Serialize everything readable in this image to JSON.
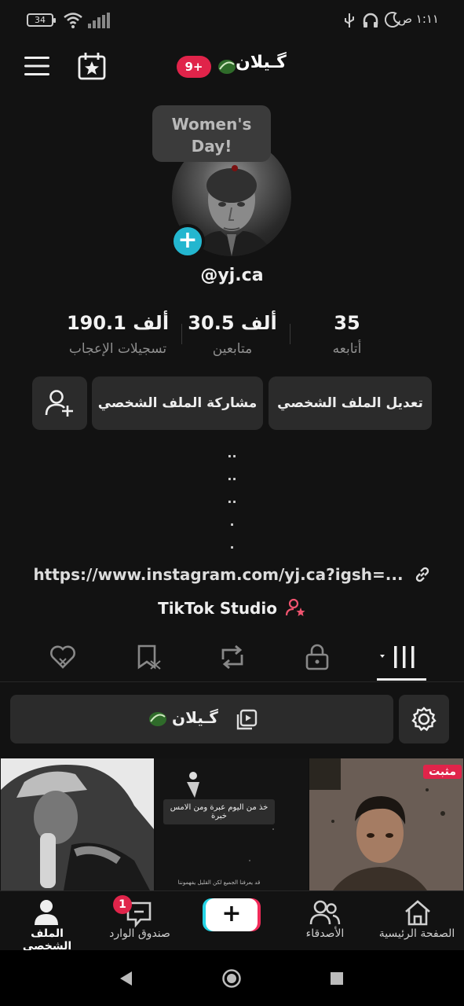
{
  "status_bar": {
    "battery": "34",
    "time": "١:١١ ص"
  },
  "header": {
    "title": "گـيلان",
    "notification_count": "9+"
  },
  "tooltip": {
    "text": "Women's Day!"
  },
  "profile": {
    "handle": "@yj.ca",
    "stats": [
      {
        "value": "190.1 ألف",
        "label": "تسجيلات الإعجاب"
      },
      {
        "value": "30.5 ألف",
        "label": "متابعين"
      },
      {
        "value": "35",
        "label": "أتابعه"
      }
    ],
    "buttons": {
      "edit": "تعديل الملف الشخصي",
      "share": "مشاركة الملف الشخصي"
    },
    "bio_lines": [
      "..",
      "..",
      "..",
      ".",
      "."
    ],
    "link": "https://www.instagram.com/yj.ca?igsh=...",
    "studio": "TikTok Studio"
  },
  "playlist": {
    "title": "گـيلان"
  },
  "videos": [
    {
      "badge": "مثبت"
    },
    {
      "caption": "خذ من اليوم عبرة ومن الامس خبرة",
      "sub": "قد يعرفنا الجميع لكن القليل يفهموننا"
    },
    {}
  ],
  "bottom_nav": {
    "profile": "الملف الشخصي",
    "inbox": "صندوق الوارد",
    "inbox_badge": "1",
    "create": "+",
    "friends": "الأصدقاء",
    "home": "الصفحة الرئيسية"
  },
  "colors": {
    "background": "#121212",
    "accent_red": "#e0244a",
    "accent_cyan": "#23b6cf",
    "button_bg": "#2b2b2b"
  },
  "icons": [
    "menu-icon",
    "calendar-star-icon",
    "add-friend-icon",
    "link-icon",
    "studio-icon",
    "grid-icon",
    "lock-icon",
    "repost-icon",
    "favorites-icon",
    "liked-icon",
    "playlist-icon",
    "gear-icon",
    "home-icon",
    "friends-icon",
    "inbox-icon",
    "profile-icon"
  ]
}
